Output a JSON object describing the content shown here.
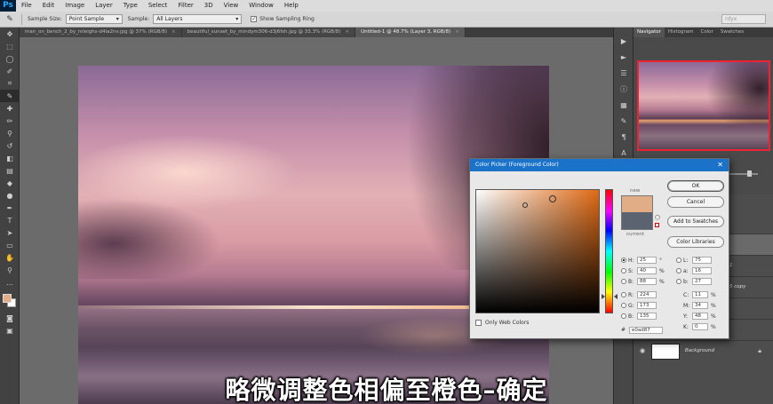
{
  "app": {
    "logo": "Ps"
  },
  "menu": [
    "File",
    "Edit",
    "Image",
    "Layer",
    "Type",
    "Select",
    "Filter",
    "3D",
    "View",
    "Window",
    "Help"
  ],
  "options": {
    "sample_size_label": "Sample Size:",
    "sample_size_value": "Point Sample",
    "sample_label": "Sample:",
    "sample_value": "All Layers",
    "show_ring_label": "Show Sampling Ring",
    "workspace_value": "rdyx"
  },
  "tabs": [
    {
      "label": "man_on_bench_2_by_mleighs-d4la2nv.jpg @ 37% (RGB/8)",
      "active": false
    },
    {
      "label": "beautiful_sunset_by_mindym306-d3j6fsh.jpg @ 33.3% (RGB/8)",
      "active": false
    },
    {
      "label": "Untitled-1 @ 48.7% (Layer 3, RGB/8)",
      "active": true
    }
  ],
  "panels": {
    "tabs": [
      "Navigator",
      "Histogram",
      "Color",
      "Swatches"
    ],
    "layers": [
      {
        "name": "",
        "selected": true
      },
      {
        "name": "",
        "selected": false
      },
      {
        "name": "",
        "selected": false
      },
      {
        "name": "",
        "selected": false
      },
      {
        "name": "",
        "selected": false
      },
      {
        "name": "Background",
        "selected": false
      }
    ],
    "layer_copy_label": "5 copy",
    "layer_num_label": "1"
  },
  "picker": {
    "title": "Color Picker (Foreground Color)",
    "new_label": "new",
    "current_label": "current",
    "buttons": {
      "ok": "OK",
      "cancel": "Cancel",
      "add_swatches": "Add to Swatches",
      "libraries": "Color Libraries"
    },
    "hsb": [
      {
        "label": "H:",
        "value": "25",
        "unit": "°"
      },
      {
        "label": "S:",
        "value": "40",
        "unit": "%"
      },
      {
        "label": "B:",
        "value": "88",
        "unit": "%"
      }
    ],
    "rgb": [
      {
        "label": "R:",
        "value": "224"
      },
      {
        "label": "G:",
        "value": "173"
      },
      {
        "label": "B:",
        "value": "135"
      }
    ],
    "lab": [
      {
        "label": "L:",
        "value": "75"
      },
      {
        "label": "a:",
        "value": "16"
      },
      {
        "label": "b:",
        "value": "27"
      }
    ],
    "cmyk": [
      {
        "label": "C:",
        "value": "11",
        "unit": "%"
      },
      {
        "label": "M:",
        "value": "34",
        "unit": "%"
      },
      {
        "label": "Y:",
        "value": "48",
        "unit": "%"
      },
      {
        "label": "K:",
        "value": "0",
        "unit": "%"
      }
    ],
    "web_colors_label": "Only Web Colors",
    "hex_label": "#",
    "hex_value": "e0ad87",
    "new_color": "#e0ad87",
    "current_color": "#5b6270"
  },
  "subtitle": "略微调整色相偏至橙色–确定"
}
